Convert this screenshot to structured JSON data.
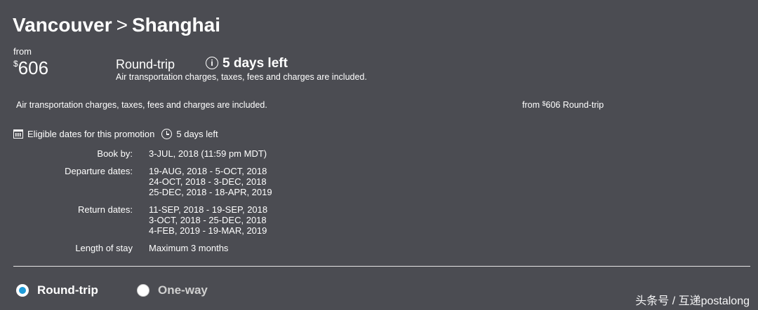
{
  "route": {
    "origin": "Vancouver",
    "separator": ">",
    "destination": "Shanghai"
  },
  "fare": {
    "from_label": "from",
    "currency_symbol": "$",
    "price": "606",
    "trip_type": "Round-trip",
    "days_left": "5 days left",
    "included_note": "Air transportation charges, taxes, fees and charges are included."
  },
  "details": {
    "included_note": "Air transportation charges, taxes, fees and charges are included.",
    "summary_from": "from",
    "summary_currency": "$",
    "summary_price": "606",
    "summary_trip": "Round-trip"
  },
  "eligibility": {
    "header": "Eligible dates for this promotion",
    "days_left": "5 days left",
    "book_by_label": "Book by:",
    "book_by_value": "3-JUL, 2018 (11:59 pm MDT)",
    "departure_label": "Departure dates:",
    "departure_dates": [
      "19-AUG, 2018 - 5-OCT, 2018",
      "24-OCT, 2018 - 3-DEC, 2018",
      "25-DEC, 2018 - 18-APR, 2019"
    ],
    "return_label": "Return dates:",
    "return_dates": [
      "11-SEP, 2018 - 19-SEP, 2018",
      "3-OCT, 2018 - 25-DEC, 2018",
      "4-FEB, 2019 - 19-MAR, 2019"
    ],
    "stay_label": "Length of stay",
    "stay_value": "Maximum 3 months"
  },
  "trip_options": {
    "round_trip": "Round-trip",
    "one_way": "One-way",
    "selected": "Round-trip",
    "accent_color": "#1f9bd8"
  },
  "watermark": "头条号 / 互递postalong"
}
